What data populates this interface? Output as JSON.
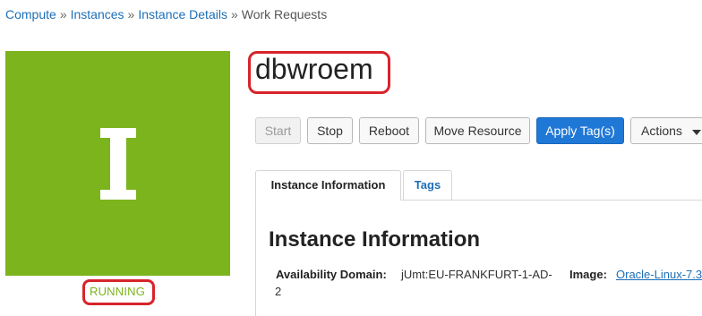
{
  "breadcrumb": {
    "items": [
      "Compute",
      "Instances",
      "Instance Details"
    ],
    "current": "Work Requests",
    "separator": "»"
  },
  "instance": {
    "tile_letter": "I",
    "tile_color": "#7cb41d",
    "status": "RUNNING",
    "name": "dbwroem"
  },
  "toolbar": {
    "start_label": "Start",
    "stop_label": "Stop",
    "reboot_label": "Reboot",
    "move_label": "Move Resource",
    "apply_tags_label": "Apply Tag(s)",
    "actions_label": "Actions"
  },
  "tabs": [
    {
      "label": "Instance Information",
      "active": true
    },
    {
      "label": "Tags",
      "active": false
    }
  ],
  "info": {
    "title": "Instance Information",
    "availability_domain_label": "Availability Domain:",
    "availability_domain_value_line1": "jUmt:EU-FRANKFURT-1-AD-",
    "availability_domain_value_line2": "2",
    "image_label": "Image:",
    "image_value": "Oracle-Linux-7.3"
  },
  "colors": {
    "accent": "#2078d6",
    "link": "#1d6fb8",
    "highlight_ring": "#d7242b"
  }
}
